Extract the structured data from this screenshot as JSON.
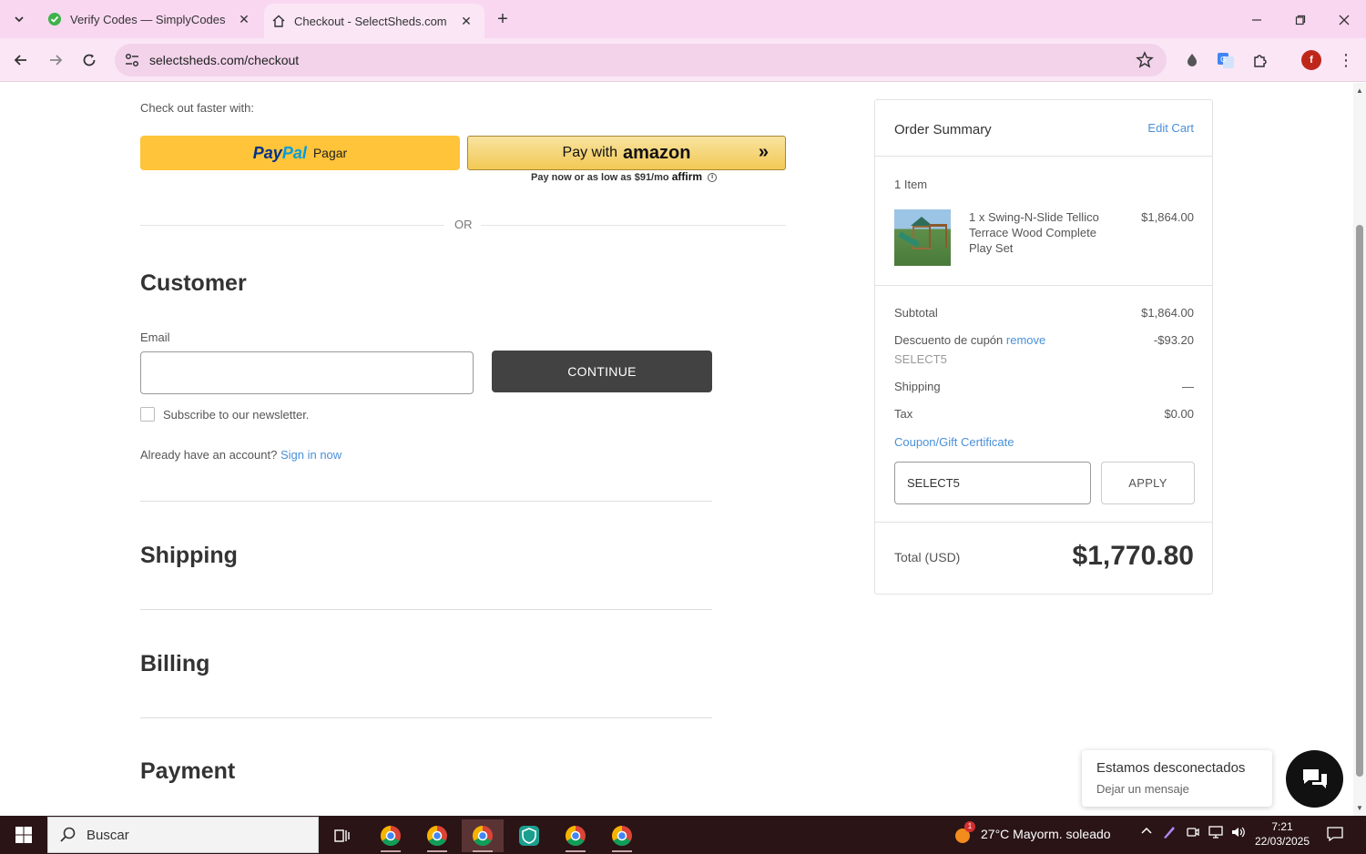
{
  "browser": {
    "tabs": [
      {
        "title": "Verify Codes — SimplyCodes",
        "icon": "simplycodes-icon"
      },
      {
        "title": "Checkout - SelectSheds.com",
        "icon": "home-icon"
      }
    ],
    "url": "selectsheds.com/checkout",
    "profile_initial": "f"
  },
  "checkout": {
    "faster_label": "Check out faster with:",
    "paypal": {
      "logo_pay": "Pay",
      "logo_pal": "Pal",
      "label": "Pagar"
    },
    "amazon": {
      "prefix": "Pay with",
      "brand": "amazon",
      "chevrons": "»"
    },
    "affirm": {
      "text": "Pay now or as low as $91/mo",
      "brand": "affirm",
      "info": "i"
    },
    "or_label": "OR",
    "customer": {
      "title": "Customer",
      "email_label": "Email",
      "email_value": "",
      "continue_label": "CONTINUE",
      "subscribe_label": "Subscribe to our newsletter.",
      "account_text": "Already have an account?",
      "sign_in_label": "Sign in now"
    },
    "sections": {
      "shipping": "Shipping",
      "billing": "Billing",
      "payment": "Payment"
    }
  },
  "summary": {
    "title": "Order Summary",
    "edit_cart": "Edit Cart",
    "items_count": "1 Item",
    "item": {
      "name": "1 x Swing-N-Slide Tellico Terrace Wood Complete Play Set",
      "price": "$1,864.00"
    },
    "subtotal_label": "Subtotal",
    "subtotal": "$1,864.00",
    "discount_label": "Descuento de cupón",
    "discount_remove": "remove",
    "discount_code": "SELECT5",
    "discount": "-$93.20",
    "shipping_label": "Shipping",
    "shipping": "—",
    "tax_label": "Tax",
    "tax": "$0.00",
    "coupon_link": "Coupon/Gift Certificate",
    "coupon_value": "SELECT5",
    "apply_label": "APPLY",
    "total_label": "Total (USD)",
    "total": "$1,770.80"
  },
  "chat": {
    "title": "Estamos desconectados",
    "subtitle": "Dejar un mensaje"
  },
  "taskbar": {
    "search_placeholder": "Buscar",
    "weather": "27°C  Mayorm. soleado",
    "weather_badge": "1",
    "time": "7:21",
    "date": "22/03/2025"
  },
  "colors": {
    "accent_link": "#4a90d9",
    "paypal_yellow": "#ffc43a",
    "continue_dark": "#424242",
    "tab_pink": "#f9d7f1"
  }
}
